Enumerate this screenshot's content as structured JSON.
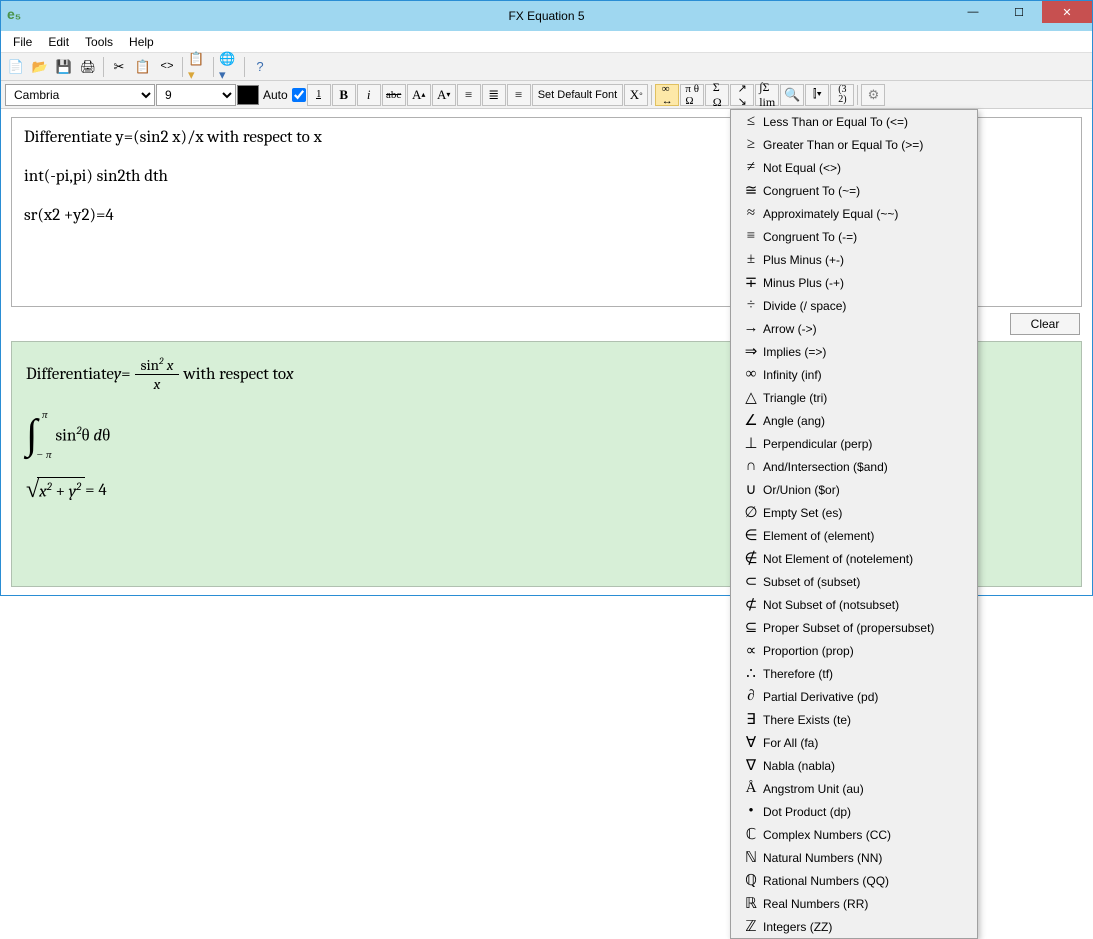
{
  "title": "FX Equation 5",
  "appIcon": "e₅",
  "menu": [
    "File",
    "Edit",
    "Tools",
    "Help"
  ],
  "font": {
    "family": "Cambria",
    "size": "9",
    "auto": "Auto"
  },
  "defaultFontBtn": "Set Default Font",
  "clearBtn": "Clear",
  "input": {
    "l1": "Differentiate y=(sin2 x)/x with respect to x",
    "l2": "int(-pi,pi) sin2th dth",
    "l3": "sr(x2 +y2)=4"
  },
  "preview": {
    "p1a": "Differentiate ",
    "p1b": "y",
    "p1c": " = ",
    "p1num": "sin",
    "p1numexp": "2",
    "p1numx": "x",
    "p1den": "x",
    "p1d": " with respect to ",
    "p1e": "x",
    "p2ul": "π",
    "p2ll": "− π",
    "p2a": "sin",
    "p2exp": "2",
    "p2b": "θ  ",
    "p2c": "d",
    "p2d": "θ",
    "p3rx": "x",
    "p3e1": "2",
    "p3plus": " + ",
    "p3ry": "y",
    "p3e2": "2",
    "p3eq": " = 4"
  },
  "dropdown": [
    {
      "sym": "≤",
      "label": "Less Than or Equal To (<=)"
    },
    {
      "sym": "≥",
      "label": "Greater Than or Equal To (>=)"
    },
    {
      "sym": "≠",
      "label": "Not Equal (<>)"
    },
    {
      "sym": "≅",
      "label": "Congruent To (~=)"
    },
    {
      "sym": "≈",
      "label": "Approximately Equal (~~)"
    },
    {
      "sym": "≡",
      "label": "Congruent To (-=)"
    },
    {
      "sym": "±",
      "label": "Plus Minus (+-)"
    },
    {
      "sym": "∓",
      "label": "Minus Plus (-+)"
    },
    {
      "sym": "÷",
      "label": "Divide (/ space)"
    },
    {
      "sym": "→",
      "label": "Arrow (->)"
    },
    {
      "sym": "⇒",
      "label": "Implies (=>)"
    },
    {
      "sym": "∞",
      "label": "Infinity (inf)"
    },
    {
      "sym": "△",
      "label": "Triangle (tri)"
    },
    {
      "sym": "∠",
      "label": "Angle (ang)"
    },
    {
      "sym": "⊥",
      "label": "Perpendicular (perp)"
    },
    {
      "sym": "∩",
      "label": "And/Intersection ($and)"
    },
    {
      "sym": "∪",
      "label": "Or/Union ($or)"
    },
    {
      "sym": "∅",
      "label": "Empty Set (es)"
    },
    {
      "sym": "∈",
      "label": "Element of (element)"
    },
    {
      "sym": "∉",
      "label": "Not Element of (notelement)"
    },
    {
      "sym": "⊂",
      "label": "Subset of (subset)"
    },
    {
      "sym": "⊄",
      "label": "Not Subset of (notsubset)"
    },
    {
      "sym": "⊆",
      "label": "Proper Subset of (propersubset)"
    },
    {
      "sym": "∝",
      "label": "Proportion (prop)"
    },
    {
      "sym": "∴",
      "label": "Therefore (tf)"
    },
    {
      "sym": "∂",
      "label": "Partial Derivative (pd)"
    },
    {
      "sym": "∃",
      "label": "There Exists (te)"
    },
    {
      "sym": "∀",
      "label": "For All (fa)"
    },
    {
      "sym": "∇",
      "label": "Nabla (nabla)"
    },
    {
      "sym": "Å",
      "label": "Angstrom Unit (au)"
    },
    {
      "sym": "•",
      "label": "Dot Product (dp)"
    },
    {
      "sym": "ℂ",
      "label": "Complex Numbers (CC)"
    },
    {
      "sym": "ℕ",
      "label": "Natural Numbers (NN)"
    },
    {
      "sym": "ℚ",
      "label": "Rational Numbers (QQ)"
    },
    {
      "sym": "ℝ",
      "label": "Real Numbers (RR)"
    },
    {
      "sym": "ℤ",
      "label": "Integers (ZZ)"
    }
  ]
}
